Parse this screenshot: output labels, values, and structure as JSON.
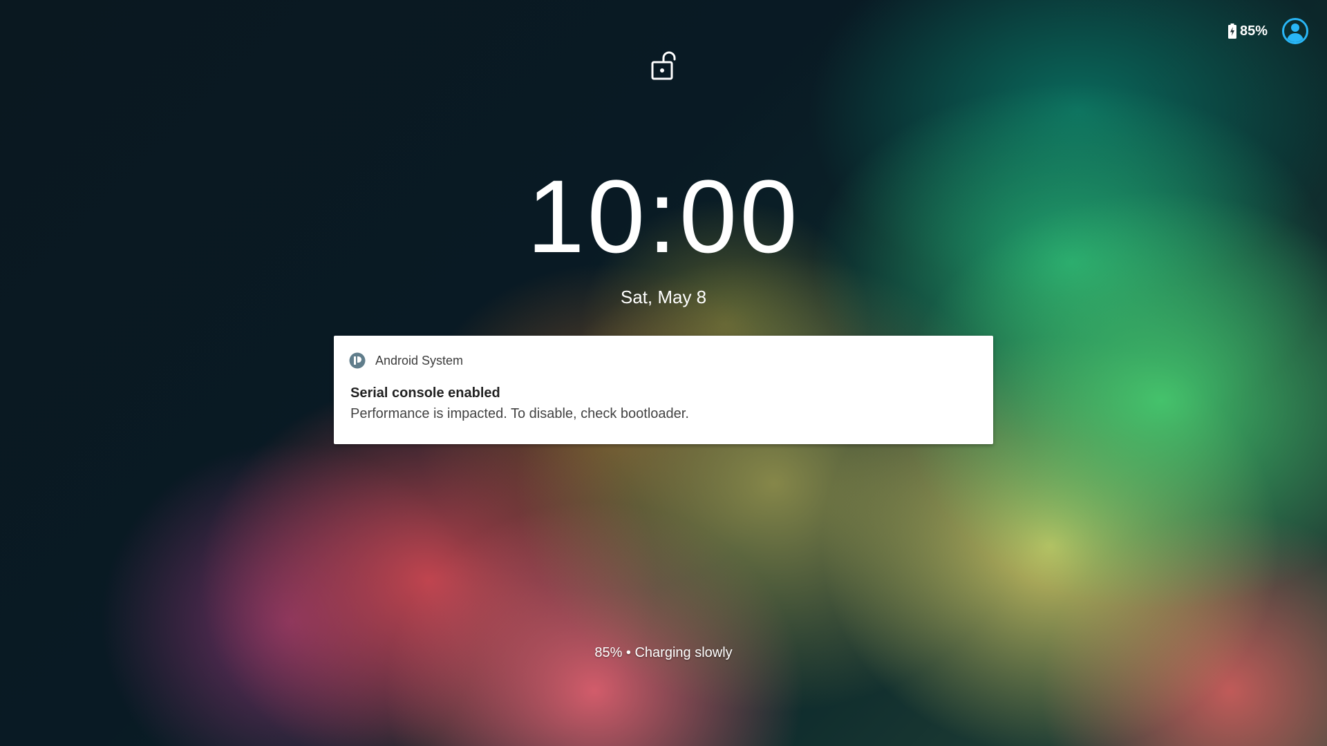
{
  "status_bar": {
    "battery_percent": "85%",
    "battery_icon": "battery-charging-icon",
    "user_icon": "account-circle-icon",
    "accent_color": "#29b6f6"
  },
  "lock": {
    "icon": "lock-open-icon"
  },
  "lockscreen": {
    "time": "10:00",
    "date": "Sat, May 8"
  },
  "notification": {
    "app_icon": "android-system-icon",
    "app_name": "Android System",
    "title": "Serial console enabled",
    "text": "Performance is impacted. To disable, check bootloader."
  },
  "charging": {
    "text": "85% • Charging slowly"
  }
}
